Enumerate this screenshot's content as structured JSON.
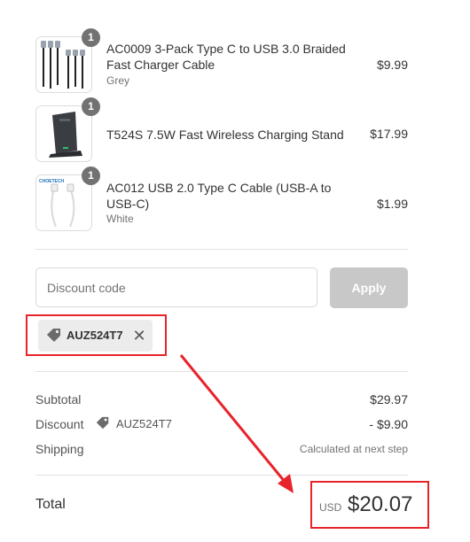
{
  "items": [
    {
      "quantity": "1",
      "title": "AC0009 3-Pack Type C to USB 3.0 Braided Fast Charger Cable",
      "variant": "Grey",
      "price": "$9.99",
      "image_icon": "braided-cables-image"
    },
    {
      "quantity": "1",
      "title": "T524S 7.5W Fast Wireless Charging Stand",
      "variant": "",
      "price": "$17.99",
      "image_icon": "wireless-stand-image"
    },
    {
      "quantity": "1",
      "title": "AC012 USB 2.0 Type C Cable (USB-A to USB-C)",
      "variant": "White",
      "price": "$1.99",
      "image_icon": "white-cable-image"
    }
  ],
  "discount_form": {
    "placeholder": "Discount code",
    "apply_label": "Apply"
  },
  "applied_code": {
    "code": "AUZ524T7",
    "icon": "tag-icon",
    "remove_icon": "close-icon"
  },
  "summary": {
    "subtotal_label": "Subtotal",
    "subtotal_value": "$29.97",
    "discount_label": "Discount",
    "discount_code": "AUZ524T7",
    "discount_value": "- $9.90",
    "shipping_label": "Shipping",
    "shipping_value": "Calculated at next step"
  },
  "total": {
    "label": "Total",
    "currency": "USD",
    "amount": "$20.07"
  },
  "colors": {
    "annotation_red": "#e8232a",
    "badge_gray": "#727272",
    "apply_disabled": "#c8c8c8",
    "tag_background": "#ececec"
  }
}
